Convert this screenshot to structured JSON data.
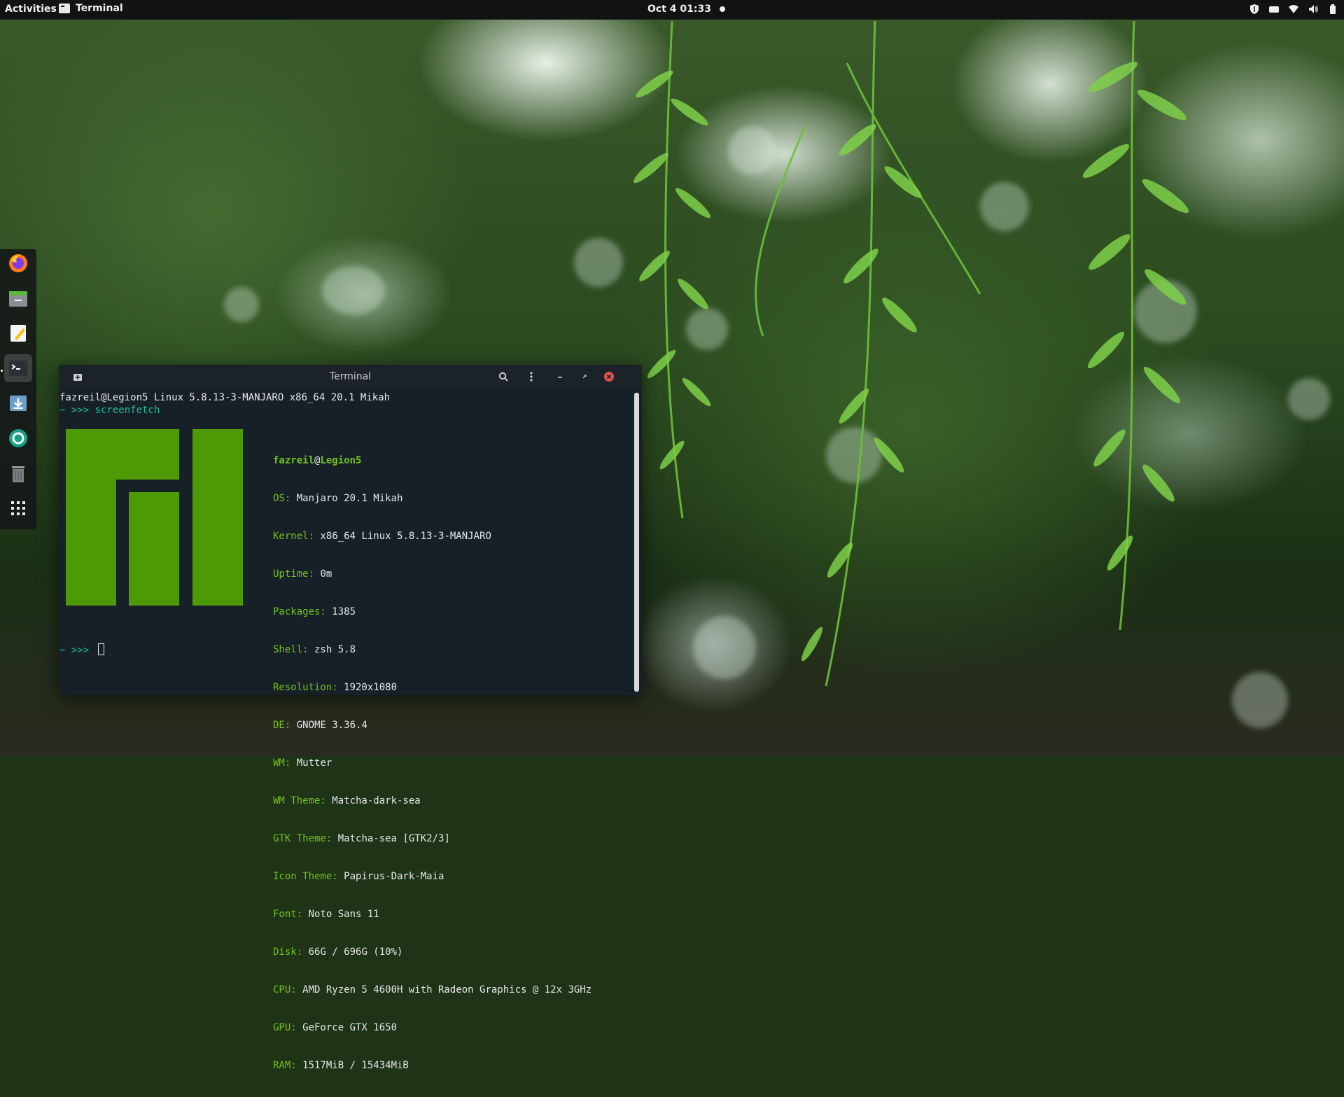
{
  "topbar": {
    "activities": "Activities",
    "app_name": "Terminal",
    "clock": "Oct 4  01:33"
  },
  "dock": {
    "items": [
      {
        "icon": "firefox-icon"
      },
      {
        "icon": "files-icon"
      },
      {
        "icon": "text-editor-icon"
      },
      {
        "icon": "terminal-icon",
        "active": true
      },
      {
        "icon": "downloader-icon"
      },
      {
        "icon": "aperture-icon"
      },
      {
        "icon": "trash-icon"
      },
      {
        "icon": "app-grid-icon"
      }
    ]
  },
  "terminal": {
    "title": "Terminal",
    "line1": "fazreil@Legion5 Linux 5.8.13-3-MANJARO x86_64 20.1 Mikah",
    "prompt": "~ >>> ",
    "command": "screenfetch",
    "user": "fazreil",
    "at": "@",
    "host": "Legion5",
    "info": [
      {
        "label": "OS:",
        "value": " Manjaro 20.1 Mikah"
      },
      {
        "label": "Kernel:",
        "value": " x86_64 Linux 5.8.13-3-MANJARO"
      },
      {
        "label": "Uptime:",
        "value": " 0m"
      },
      {
        "label": "Packages:",
        "value": " 1385"
      },
      {
        "label": "Shell:",
        "value": " zsh 5.8"
      },
      {
        "label": "Resolution:",
        "value": " 1920x1080"
      },
      {
        "label": "DE:",
        "value": " GNOME 3.36.4"
      },
      {
        "label": "WM:",
        "value": " Mutter"
      },
      {
        "label": "WM Theme:",
        "value": " Matcha-dark-sea"
      },
      {
        "label": "GTK Theme:",
        "value": " Matcha-sea [GTK2/3]"
      },
      {
        "label": "Icon Theme:",
        "value": " Papirus-Dark-Maia"
      },
      {
        "label": "Font:",
        "value": " Noto Sans 11"
      },
      {
        "label": "Disk:",
        "value": " 66G / 696G (10%)"
      },
      {
        "label": "CPU:",
        "value": " AMD Ryzen 5 4600H with Radeon Graphics @ 12x 3GHz"
      },
      {
        "label": "GPU:",
        "value": " GeForce GTX 1650"
      },
      {
        "label": "RAM:",
        "value": " 1517MiB / 15434MiB"
      }
    ],
    "prompt2": "~ >>> "
  },
  "colors": {
    "accent_teal": "#1abc9c",
    "manjaro_green": "#6ec31a",
    "logo_green": "#4e9a06",
    "terminal_bg": "#182027"
  }
}
